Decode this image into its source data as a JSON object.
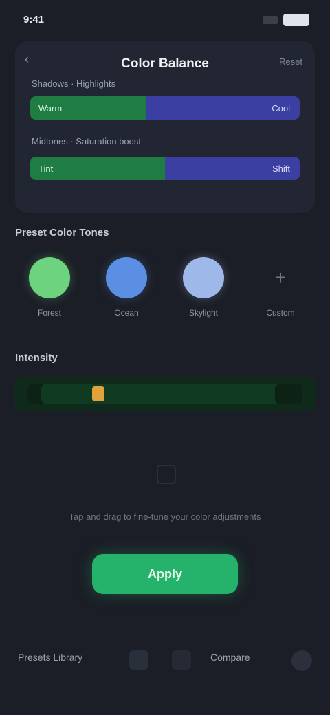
{
  "status": {
    "time": "9:41"
  },
  "card": {
    "title": "Color Balance",
    "action": "Reset",
    "rows": [
      {
        "label": "Shadows · Highlights",
        "left_label": "Warm",
        "right_label": "Cool",
        "left_fraction": 0.43
      },
      {
        "label": "Midtones · Saturation boost",
        "left_label": "Tint",
        "right_label": "Shift",
        "left_fraction": 0.5
      }
    ]
  },
  "presets": {
    "title": "Preset Color Tones",
    "items": [
      {
        "label": "Forest",
        "color": "#6ed37f"
      },
      {
        "label": "Ocean",
        "color": "#5b8fe3"
      },
      {
        "label": "Skylight",
        "color": "#9fb8ea"
      },
      {
        "label": "Custom",
        "color": ""
      }
    ]
  },
  "timeline": {
    "title": "Intensity",
    "position": 0.2
  },
  "hint": "Tap and drag to fine‑tune your color adjustments",
  "cta": {
    "label": "Apply"
  },
  "bottom": {
    "left": "Presets Library",
    "right": "Compare"
  }
}
